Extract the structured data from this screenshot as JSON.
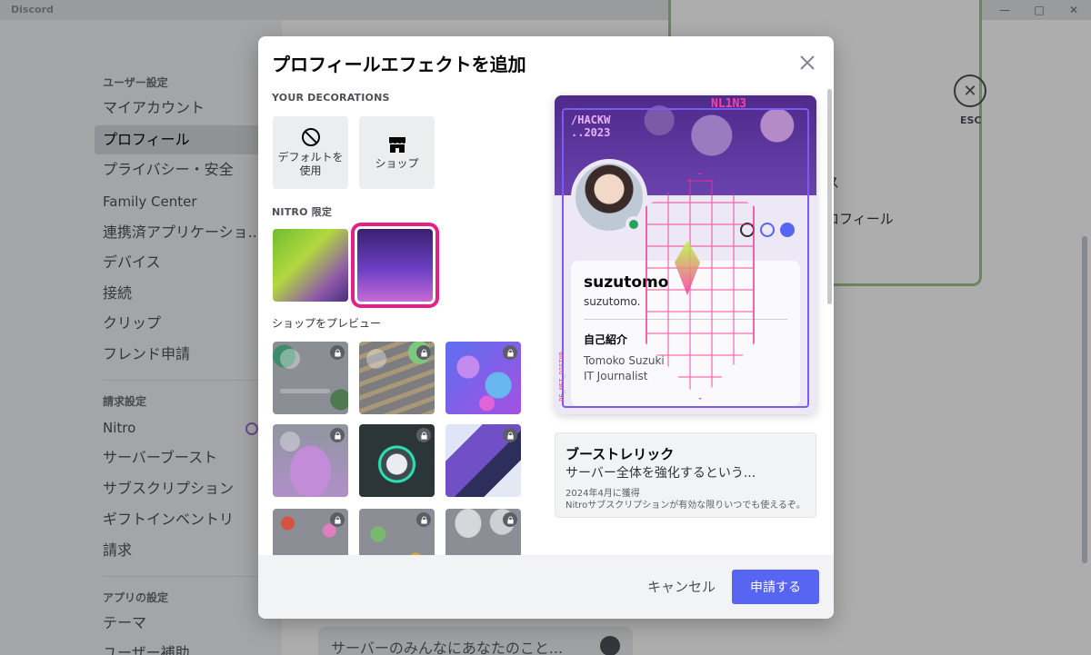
{
  "window": {
    "title": "Discord"
  },
  "sidebar": {
    "groups": [
      "ユーザー設定",
      "請求設定",
      "アプリの設定"
    ],
    "items": [
      "マイアカウント",
      "プロフィール",
      "プライバシー・安全",
      "Family Center",
      "連携済アプリケーショ...",
      "デバイス",
      "接続",
      "クリップ",
      "フレンド申請",
      "Nitro",
      "サーバーブースト",
      "サブスクリプション",
      "ギフトインベントリ",
      "請求",
      "テーマ",
      "ユーザー補助"
    ]
  },
  "background": {
    "esc_label": "ESC",
    "row_partial_1": "ス",
    "row_partial_2": "ロフィール",
    "input_placeholder": "サーバーのみんなにあなたのこと..."
  },
  "modal": {
    "title": "プロフィールエフェクトを追加",
    "sections": {
      "decorations": "YOUR DECORATIONS",
      "nitro": "NITRO 限定",
      "shop": "ショップをプレビュー"
    },
    "default_tile_label": "デフォルトを\n使用",
    "shop_tile_label": "ショップ",
    "preview": {
      "hack_text": "/HACKW\n..2023",
      "nl_text": "NL1N3",
      "display_name": "suzutomo",
      "username": "suzutomo.",
      "about_heading": "自己紹介",
      "about_text": "Tomoko Suzuki\nIT Journalist",
      "side_text": "DE_NET_DISTUR"
    },
    "boost": {
      "title": "ブーストレリック",
      "description": "サーバー全体を強化するという...",
      "date": "2024年4月に獲得",
      "note": "Nitroサブスクリプションが有効な限りいつでも使えるぞ。"
    },
    "footer": {
      "cancel": "キャンセル",
      "apply": "申請する"
    }
  },
  "colors": {
    "accent": "#5865f2",
    "selection": "#e51f86",
    "status_online": "#23a559"
  }
}
